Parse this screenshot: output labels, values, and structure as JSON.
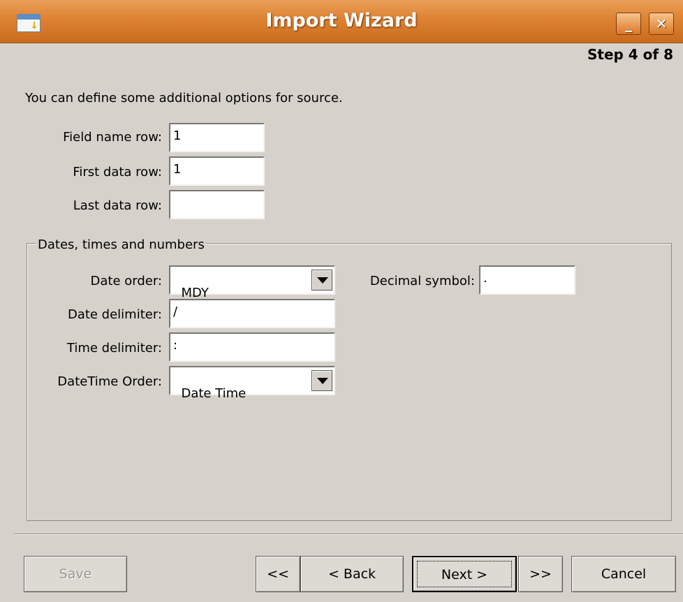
{
  "window": {
    "title": "Import Wizard",
    "minimize_glyph": "_",
    "close_glyph": "✕"
  },
  "step": "Step 4 of 8",
  "intro": "You can define some additional options for source.",
  "rows": {
    "field_name_label": "Field name row:",
    "field_name_value": "1",
    "first_data_label": "First data row:",
    "first_data_value": "1",
    "last_data_label": "Last data row:",
    "last_data_value": ""
  },
  "dates_group": {
    "title": "Dates, times and numbers",
    "date_order_label": "Date order:",
    "date_order_value": "MDY",
    "decimal_label": "Decimal symbol:",
    "decimal_value": ".",
    "date_delim_label": "Date delimiter:",
    "date_delim_value": "/",
    "time_delim_label": "Time delimiter:",
    "time_delim_value": ":",
    "datetime_order_label": "DateTime Order:",
    "datetime_order_value": "Date Time"
  },
  "buttons": {
    "save": "Save",
    "first": "<<",
    "back": "< Back",
    "next": "Next >",
    "last": ">>",
    "cancel": "Cancel"
  }
}
